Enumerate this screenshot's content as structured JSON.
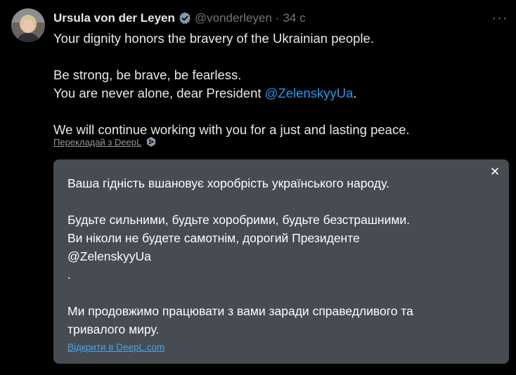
{
  "author": {
    "name": "Ursula von der Leyen",
    "handle": "@vonderleyen",
    "separator": "·",
    "time": "34 с"
  },
  "more_glyph": "···",
  "tweet": {
    "line1": "Your dignity honors the bravery of the Ukrainian people.",
    "line2": "Be strong, be brave, be fearless.",
    "line3_prefix": "You are never alone, dear President ",
    "line3_mention": "@ZelenskyyUa",
    "line3_suffix": ".",
    "line4": "We will continue working with you for a just and lasting peace."
  },
  "translate_link": "Перекладай з DeepL",
  "translation": {
    "close_glyph": "✕",
    "line1": "Ваша гідність вшановує хоробрість українського народу.",
    "line2": "Будьте сильними, будьте хоробрими, будьте безстрашними.",
    "line3": "Ви ніколи не будете самотнім, дорогий Президенте",
    "line4": "@ZelenskyyUa",
    "line5": ".",
    "line6": "Ми продовжимо працювати з вами заради справедливого та",
    "line7": "тривалого миру.",
    "open_link": "Відкрити в DeepL.com"
  },
  "colors": {
    "background": "#000000",
    "text": "#e7e9ea",
    "muted": "#71767b",
    "mention": "#1d9bf0",
    "panel": "#464c52",
    "verified": "#829aab"
  },
  "icons": {
    "verified": "verified-badge-icon",
    "more": "more-horizontal-icon",
    "deepl": "deepl-icon",
    "close": "close-icon"
  }
}
